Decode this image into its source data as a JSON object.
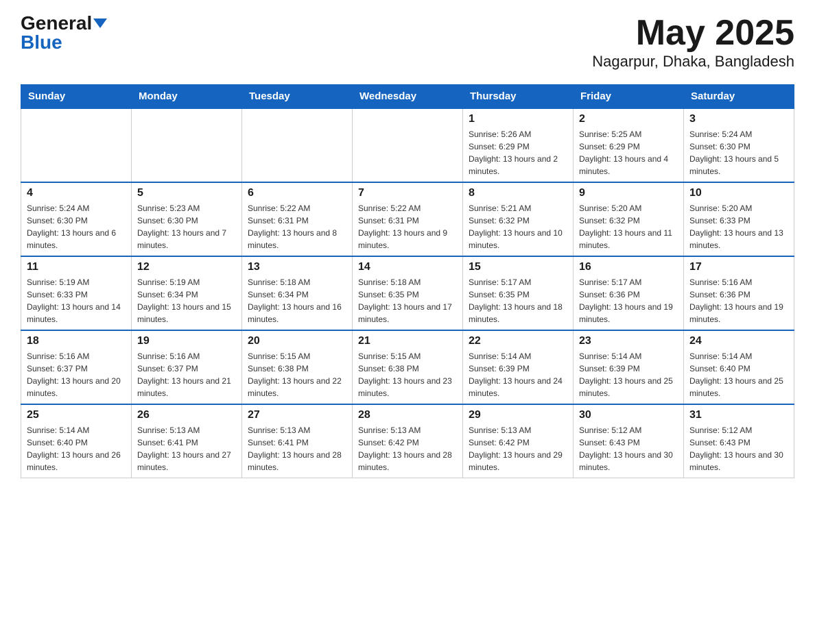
{
  "logo": {
    "general": "General",
    "blue": "Blue"
  },
  "title": "May 2025",
  "subtitle": "Nagarpur, Dhaka, Bangladesh",
  "weekdays": [
    "Sunday",
    "Monday",
    "Tuesday",
    "Wednesday",
    "Thursday",
    "Friday",
    "Saturday"
  ],
  "weeks": [
    [
      {
        "day": "",
        "info": ""
      },
      {
        "day": "",
        "info": ""
      },
      {
        "day": "",
        "info": ""
      },
      {
        "day": "",
        "info": ""
      },
      {
        "day": "1",
        "info": "Sunrise: 5:26 AM\nSunset: 6:29 PM\nDaylight: 13 hours and 2 minutes."
      },
      {
        "day": "2",
        "info": "Sunrise: 5:25 AM\nSunset: 6:29 PM\nDaylight: 13 hours and 4 minutes."
      },
      {
        "day": "3",
        "info": "Sunrise: 5:24 AM\nSunset: 6:30 PM\nDaylight: 13 hours and 5 minutes."
      }
    ],
    [
      {
        "day": "4",
        "info": "Sunrise: 5:24 AM\nSunset: 6:30 PM\nDaylight: 13 hours and 6 minutes."
      },
      {
        "day": "5",
        "info": "Sunrise: 5:23 AM\nSunset: 6:30 PM\nDaylight: 13 hours and 7 minutes."
      },
      {
        "day": "6",
        "info": "Sunrise: 5:22 AM\nSunset: 6:31 PM\nDaylight: 13 hours and 8 minutes."
      },
      {
        "day": "7",
        "info": "Sunrise: 5:22 AM\nSunset: 6:31 PM\nDaylight: 13 hours and 9 minutes."
      },
      {
        "day": "8",
        "info": "Sunrise: 5:21 AM\nSunset: 6:32 PM\nDaylight: 13 hours and 10 minutes."
      },
      {
        "day": "9",
        "info": "Sunrise: 5:20 AM\nSunset: 6:32 PM\nDaylight: 13 hours and 11 minutes."
      },
      {
        "day": "10",
        "info": "Sunrise: 5:20 AM\nSunset: 6:33 PM\nDaylight: 13 hours and 13 minutes."
      }
    ],
    [
      {
        "day": "11",
        "info": "Sunrise: 5:19 AM\nSunset: 6:33 PM\nDaylight: 13 hours and 14 minutes."
      },
      {
        "day": "12",
        "info": "Sunrise: 5:19 AM\nSunset: 6:34 PM\nDaylight: 13 hours and 15 minutes."
      },
      {
        "day": "13",
        "info": "Sunrise: 5:18 AM\nSunset: 6:34 PM\nDaylight: 13 hours and 16 minutes."
      },
      {
        "day": "14",
        "info": "Sunrise: 5:18 AM\nSunset: 6:35 PM\nDaylight: 13 hours and 17 minutes."
      },
      {
        "day": "15",
        "info": "Sunrise: 5:17 AM\nSunset: 6:35 PM\nDaylight: 13 hours and 18 minutes."
      },
      {
        "day": "16",
        "info": "Sunrise: 5:17 AM\nSunset: 6:36 PM\nDaylight: 13 hours and 19 minutes."
      },
      {
        "day": "17",
        "info": "Sunrise: 5:16 AM\nSunset: 6:36 PM\nDaylight: 13 hours and 19 minutes."
      }
    ],
    [
      {
        "day": "18",
        "info": "Sunrise: 5:16 AM\nSunset: 6:37 PM\nDaylight: 13 hours and 20 minutes."
      },
      {
        "day": "19",
        "info": "Sunrise: 5:16 AM\nSunset: 6:37 PM\nDaylight: 13 hours and 21 minutes."
      },
      {
        "day": "20",
        "info": "Sunrise: 5:15 AM\nSunset: 6:38 PM\nDaylight: 13 hours and 22 minutes."
      },
      {
        "day": "21",
        "info": "Sunrise: 5:15 AM\nSunset: 6:38 PM\nDaylight: 13 hours and 23 minutes."
      },
      {
        "day": "22",
        "info": "Sunrise: 5:14 AM\nSunset: 6:39 PM\nDaylight: 13 hours and 24 minutes."
      },
      {
        "day": "23",
        "info": "Sunrise: 5:14 AM\nSunset: 6:39 PM\nDaylight: 13 hours and 25 minutes."
      },
      {
        "day": "24",
        "info": "Sunrise: 5:14 AM\nSunset: 6:40 PM\nDaylight: 13 hours and 25 minutes."
      }
    ],
    [
      {
        "day": "25",
        "info": "Sunrise: 5:14 AM\nSunset: 6:40 PM\nDaylight: 13 hours and 26 minutes."
      },
      {
        "day": "26",
        "info": "Sunrise: 5:13 AM\nSunset: 6:41 PM\nDaylight: 13 hours and 27 minutes."
      },
      {
        "day": "27",
        "info": "Sunrise: 5:13 AM\nSunset: 6:41 PM\nDaylight: 13 hours and 28 minutes."
      },
      {
        "day": "28",
        "info": "Sunrise: 5:13 AM\nSunset: 6:42 PM\nDaylight: 13 hours and 28 minutes."
      },
      {
        "day": "29",
        "info": "Sunrise: 5:13 AM\nSunset: 6:42 PM\nDaylight: 13 hours and 29 minutes."
      },
      {
        "day": "30",
        "info": "Sunrise: 5:12 AM\nSunset: 6:43 PM\nDaylight: 13 hours and 30 minutes."
      },
      {
        "day": "31",
        "info": "Sunrise: 5:12 AM\nSunset: 6:43 PM\nDaylight: 13 hours and 30 minutes."
      }
    ]
  ]
}
